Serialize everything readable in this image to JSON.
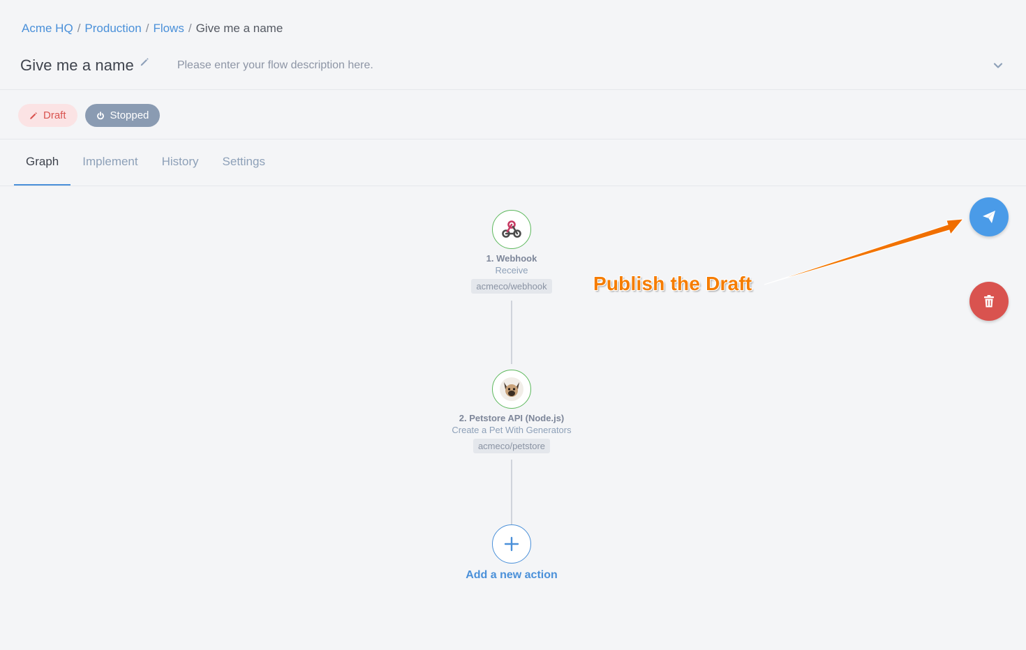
{
  "breadcrumb": {
    "items": [
      "Acme HQ",
      "Production",
      "Flows"
    ],
    "separator": "/",
    "current": "Give me a name"
  },
  "flow": {
    "title": "Give me a name",
    "description_placeholder": "Please enter your flow description here."
  },
  "badges": {
    "draft": "Draft",
    "stopped": "Stopped"
  },
  "tabs": [
    {
      "label": "Graph",
      "active": true
    },
    {
      "label": "Implement",
      "active": false
    },
    {
      "label": "History",
      "active": false
    },
    {
      "label": "Settings",
      "active": false
    }
  ],
  "graph": {
    "nodes": [
      {
        "title": "1. Webhook",
        "subtitle": "Receive",
        "tag": "acmeco/webhook",
        "icon": "webhook-icon"
      },
      {
        "title": "2. Petstore API (Node.js)",
        "subtitle": "Create a Pet With Generators",
        "tag": "acmeco/petstore",
        "icon": "dog-avatar-icon"
      }
    ],
    "add_action_label": "Add a new action"
  },
  "annotation": {
    "text": "Publish the Draft",
    "color": "#f57c00"
  },
  "colors": {
    "accent": "#4a90d9",
    "publish": "#4a9be8",
    "delete": "#d9534f",
    "node_border": "#5cb85c",
    "stopped_badge": "#8a9bb2"
  }
}
